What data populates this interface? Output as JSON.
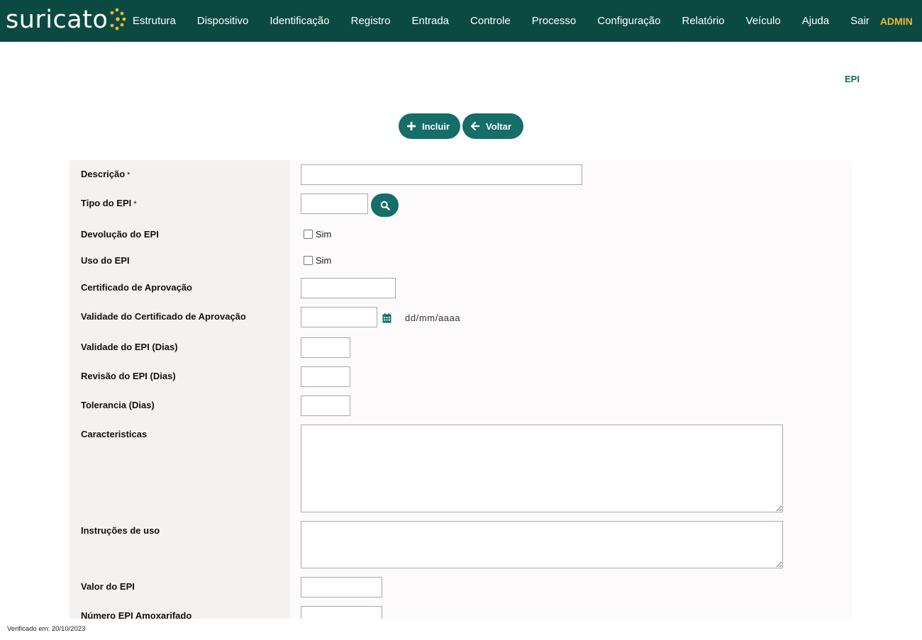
{
  "brand": {
    "name": "suricato",
    "dot_color": "#f1b82d",
    "bg_color": "#0b4a43"
  },
  "nav": {
    "items": [
      "Estrutura",
      "Dispositivo",
      "Identificação",
      "Registro",
      "Entrada",
      "Controle",
      "Processo",
      "Configuração",
      "Relatório",
      "Veículo",
      "Ajuda",
      "Sair"
    ],
    "user": "ADMIN"
  },
  "page": {
    "title": "EPI"
  },
  "actions": {
    "incluir": "Incluir",
    "voltar": "Voltar"
  },
  "form": {
    "descricao": {
      "label": "Descrição",
      "value": ""
    },
    "tipo_epi": {
      "label": "Tipo do EPI",
      "value": ""
    },
    "required_mark": "*",
    "devolucao": {
      "label": "Devolução do EPI",
      "option": "Sim",
      "checked": false
    },
    "uso": {
      "label": "Uso do EPI",
      "option": "Sim",
      "checked": false
    },
    "certificado": {
      "label": "Certificado de Aprovação",
      "value": ""
    },
    "validade_certificado": {
      "label": "Validade do Certificado de Aprovação",
      "value": "",
      "hint": "dd/mm/aaaa"
    },
    "validade_epi": {
      "label": "Validade do EPI (Dias)",
      "value": ""
    },
    "revisao_epi": {
      "label": "Revisão do EPI (Dias)",
      "value": ""
    },
    "tolerancia": {
      "label": "Tolerancia (Dias)",
      "value": ""
    },
    "caracteristicas": {
      "label": "Caracteristicas",
      "value": ""
    },
    "instrucoes": {
      "label": "Instruções de uso",
      "value": ""
    },
    "valor_epi": {
      "label": "Valor do EPI",
      "value": ""
    },
    "numero_almoxarifado": {
      "label": "Número EPI Amoxarifado",
      "value": ""
    }
  },
  "footer": {
    "text": "Verificado em: 20/10/2023"
  },
  "icons": {
    "plus": "plus-icon",
    "back": "arrow-left-icon",
    "search": "search-icon",
    "calendar": "calendar-icon",
    "logo_dots": "logo-dots-icon"
  }
}
